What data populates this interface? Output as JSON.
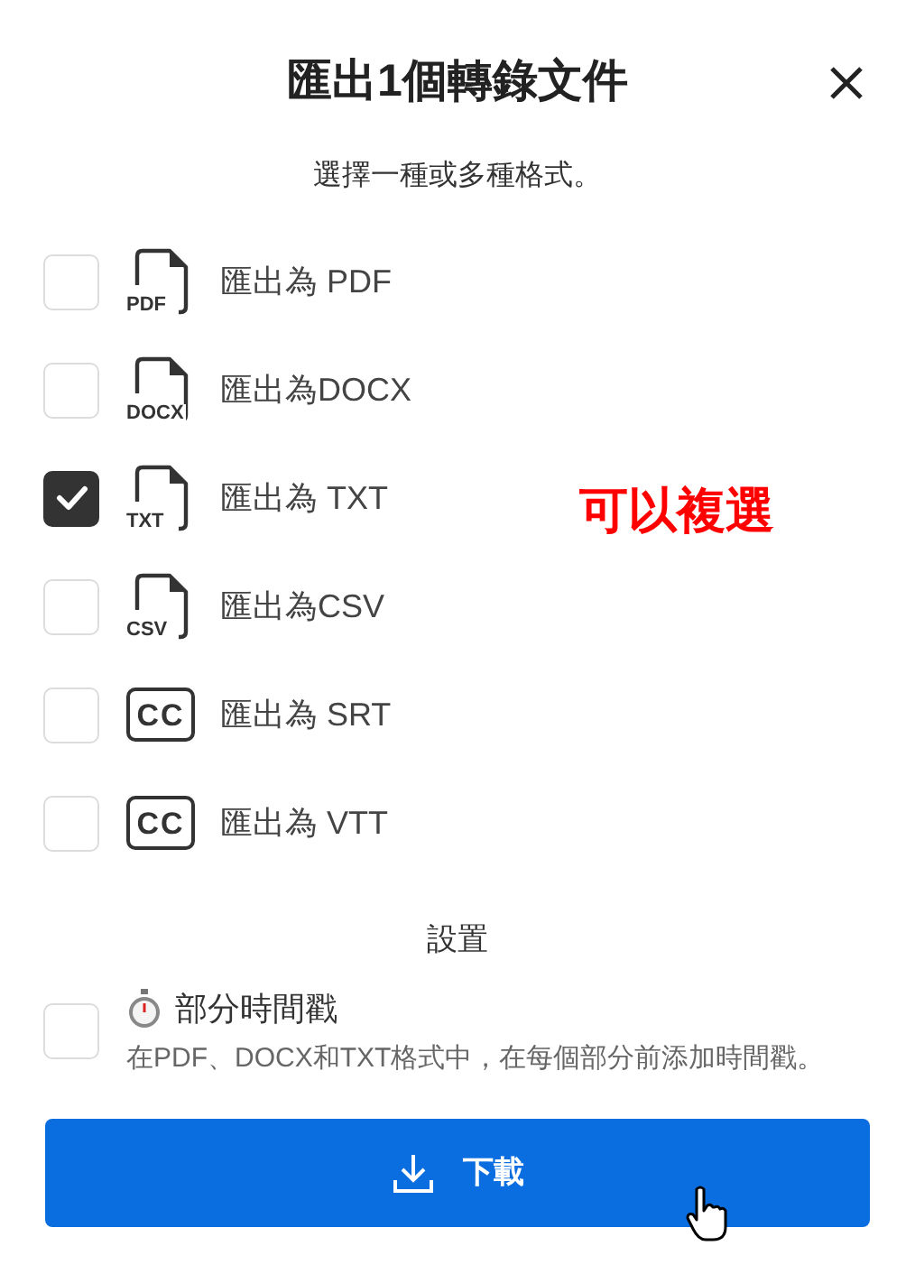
{
  "dialog": {
    "title": "匯出1個轉錄文件",
    "subtitle": "選擇一種或多種格式。"
  },
  "formats": [
    {
      "kind": "file",
      "icon_label": "PDF",
      "label": "匯出為 PDF",
      "checked": false
    },
    {
      "kind": "file",
      "icon_label": "DOCX",
      "label": "匯出為DOCX",
      "checked": false
    },
    {
      "kind": "file",
      "icon_label": "TXT",
      "label": "匯出為 TXT",
      "checked": true
    },
    {
      "kind": "file",
      "icon_label": "CSV",
      "label": "匯出為CSV",
      "checked": false
    },
    {
      "kind": "cc",
      "icon_label": "CC",
      "label": "匯出為 SRT",
      "checked": false
    },
    {
      "kind": "cc",
      "icon_label": "CC",
      "label": "匯出為 VTT",
      "checked": false
    }
  ],
  "annotation": "可以複選",
  "settings": {
    "heading": "設置",
    "timestamp": {
      "label": "部分時間戳",
      "description": "在PDF、DOCX和TXT格式中，在每個部分前添加時間戳。",
      "checked": false
    }
  },
  "download_button": "下載"
}
